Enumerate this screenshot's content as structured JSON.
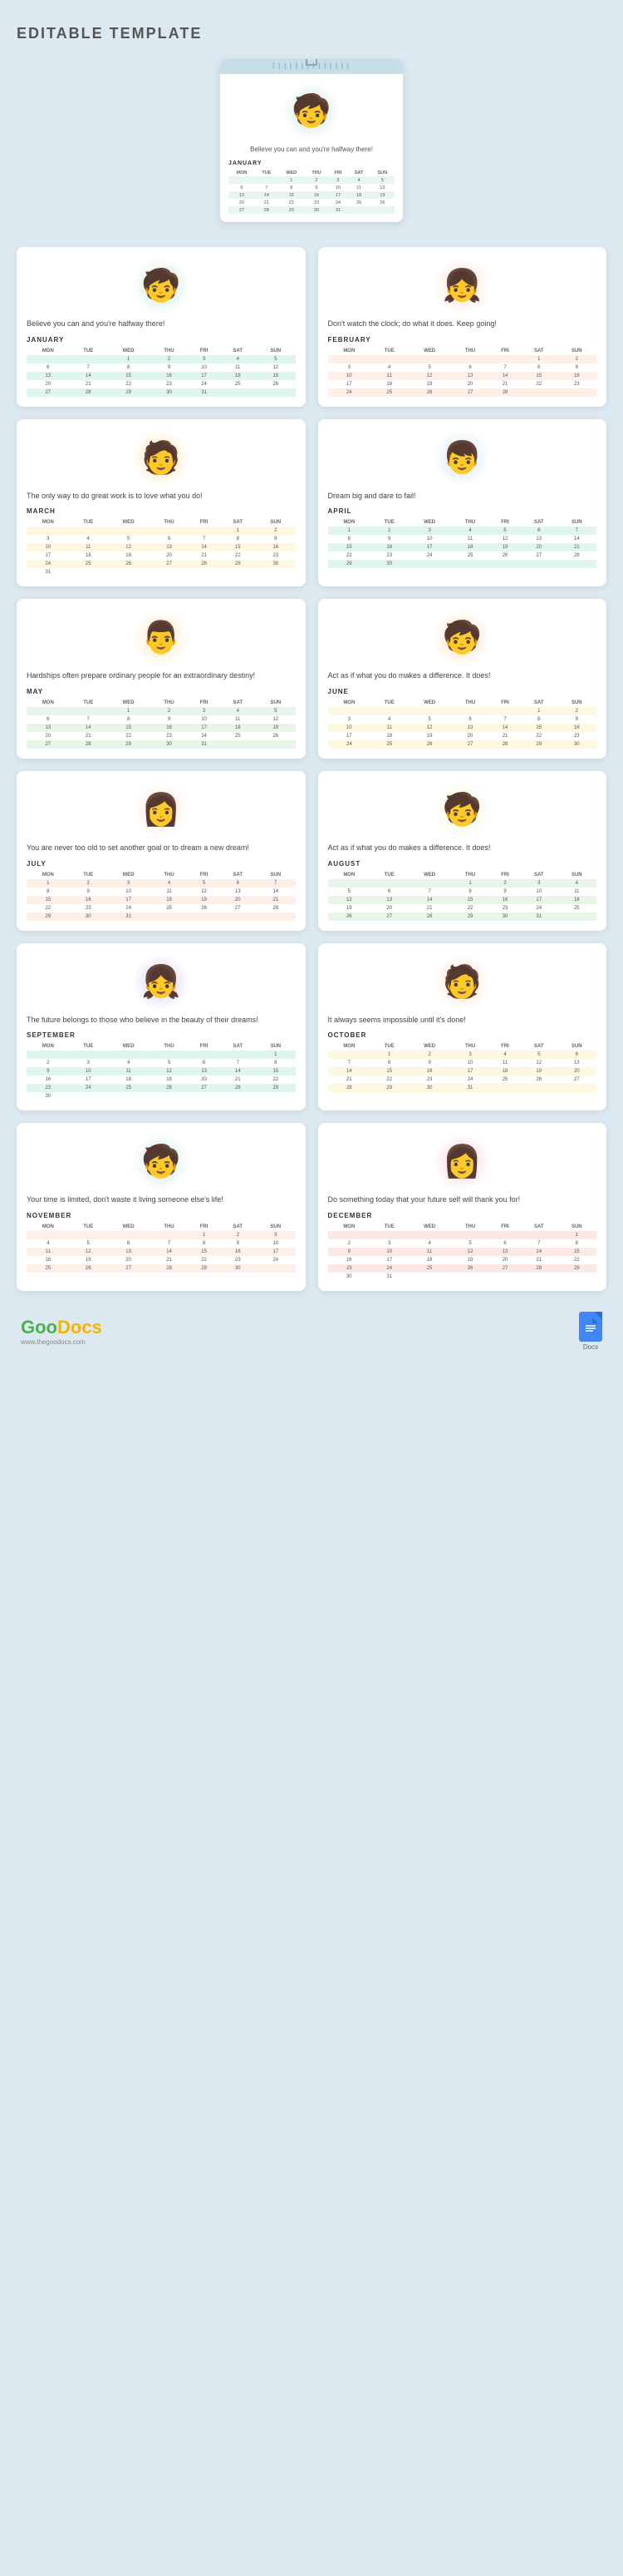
{
  "page": {
    "title": "EDITABLE TEMPLATE",
    "background": "#dce9f0"
  },
  "preview": {
    "quote": "Believe you can and you're halfway there!",
    "month": "JANUARY",
    "illustration": "🧒"
  },
  "months": [
    {
      "id": "january",
      "name": "JANUARY",
      "quote": "Believe you can and you're halfway there!",
      "illustration": "🧒",
      "illustration_class": "illus-jan",
      "rows": [
        [
          "",
          "",
          "1",
          "2",
          "3",
          "4",
          "5"
        ],
        [
          "6",
          "7",
          "8",
          "9",
          "10",
          "11",
          "12"
        ],
        [
          "13",
          "14",
          "15",
          "16",
          "17",
          "18",
          "19"
        ],
        [
          "20",
          "21",
          "22",
          "23",
          "24",
          "25",
          "26"
        ],
        [
          "27",
          "28",
          "29",
          "30",
          "31",
          "",
          ""
        ]
      ],
      "row_classes": [
        "row-teal",
        "row-white",
        "row-teal",
        "row-white",
        "row-teal"
      ]
    },
    {
      "id": "february",
      "name": "FEBRUARY",
      "quote": "Don't watch the clock; do what it does. Keep going!",
      "illustration": "👧",
      "illustration_class": "illus-feb",
      "rows": [
        [
          "",
          "",
          "",
          "",
          "",
          "1",
          "2"
        ],
        [
          "3",
          "4",
          "5",
          "6",
          "7",
          "8",
          "9"
        ],
        [
          "10",
          "11",
          "12",
          "13",
          "14",
          "15",
          "16"
        ],
        [
          "17",
          "18",
          "19",
          "20",
          "21",
          "22",
          "23"
        ],
        [
          "24",
          "25",
          "26",
          "27",
          "28",
          "",
          ""
        ]
      ],
      "row_classes": [
        "row-peach",
        "row-white",
        "row-peach",
        "row-white",
        "row-peach"
      ]
    },
    {
      "id": "march",
      "name": "MARCH",
      "quote": "The only way to do great work is to love what you do!",
      "illustration": "🧑",
      "illustration_class": "illus-mar",
      "rows": [
        [
          "",
          "",
          "",
          "",
          "",
          "1",
          "2"
        ],
        [
          "3",
          "4",
          "5",
          "6",
          "7",
          "8",
          "9"
        ],
        [
          "10",
          "11",
          "12",
          "13",
          "14",
          "15",
          "16"
        ],
        [
          "17",
          "18",
          "19",
          "20",
          "21",
          "22",
          "23"
        ],
        [
          "24",
          "25",
          "26",
          "27",
          "28",
          "29",
          "30"
        ],
        [
          "31",
          "",
          "",
          "",
          "",
          "",
          ""
        ]
      ],
      "row_classes": [
        "row-yellow",
        "row-white",
        "row-yellow",
        "row-white",
        "row-yellow",
        "row-white"
      ]
    },
    {
      "id": "april",
      "name": "APRIL",
      "quote": "Dream big and dare to fail!",
      "illustration": "👦",
      "illustration_class": "illus-apr",
      "rows": [
        [
          "1",
          "2",
          "3",
          "4",
          "5",
          "6",
          "7"
        ],
        [
          "8",
          "9",
          "10",
          "11",
          "12",
          "13",
          "14"
        ],
        [
          "15",
          "16",
          "17",
          "18",
          "19",
          "20",
          "21"
        ],
        [
          "22",
          "23",
          "24",
          "25",
          "26",
          "27",
          "28"
        ],
        [
          "29",
          "30",
          "",
          "",
          "",
          "",
          ""
        ]
      ],
      "row_classes": [
        "row-teal",
        "row-white",
        "row-teal",
        "row-white",
        "row-teal"
      ]
    },
    {
      "id": "may",
      "name": "MAY",
      "quote": "Hardships often prepare ordinary people for an extraordinary destiny!",
      "illustration": "👨",
      "illustration_class": "illus-may",
      "rows": [
        [
          "",
          "",
          "1",
          "2",
          "3",
          "4",
          "5"
        ],
        [
          "6",
          "7",
          "8",
          "9",
          "10",
          "11",
          "12"
        ],
        [
          "13",
          "14",
          "15",
          "16",
          "17",
          "18",
          "19"
        ],
        [
          "20",
          "21",
          "22",
          "23",
          "24",
          "25",
          "26"
        ],
        [
          "27",
          "28",
          "29",
          "30",
          "31",
          "",
          ""
        ]
      ],
      "row_classes": [
        "row-green",
        "row-white",
        "row-green",
        "row-white",
        "row-green"
      ]
    },
    {
      "id": "june",
      "name": "JUNE",
      "quote": "Act as if what you do makes a difference. It does!",
      "illustration": "🧒",
      "illustration_class": "illus-jun",
      "rows": [
        [
          "",
          "",
          "",
          "",
          "",
          "1",
          "2"
        ],
        [
          "3",
          "4",
          "5",
          "6",
          "7",
          "8",
          "9"
        ],
        [
          "10",
          "11",
          "12",
          "13",
          "14",
          "15",
          "16"
        ],
        [
          "17",
          "18",
          "19",
          "20",
          "21",
          "22",
          "23"
        ],
        [
          "24",
          "25",
          "26",
          "27",
          "28",
          "29",
          "30"
        ]
      ],
      "row_classes": [
        "row-yellow",
        "row-white",
        "row-yellow",
        "row-white",
        "row-yellow"
      ]
    },
    {
      "id": "july",
      "name": "JULY",
      "quote": "You are never too old to set another goal or to dream a new dream!",
      "illustration": "👩",
      "illustration_class": "illus-jul",
      "rows": [
        [
          "1",
          "2",
          "3",
          "4",
          "5",
          "6",
          "7"
        ],
        [
          "8",
          "9",
          "10",
          "11",
          "12",
          "13",
          "14"
        ],
        [
          "15",
          "16",
          "17",
          "18",
          "19",
          "20",
          "21"
        ],
        [
          "22",
          "23",
          "24",
          "25",
          "26",
          "27",
          "28"
        ],
        [
          "29",
          "30",
          "31",
          "",
          "",
          "",
          ""
        ]
      ],
      "row_classes": [
        "row-peach",
        "row-white",
        "row-peach",
        "row-white",
        "row-peach"
      ]
    },
    {
      "id": "august",
      "name": "AUGUST",
      "quote": "Act as if what you do makes a difference. It does!",
      "illustration": "🧒",
      "illustration_class": "illus-aug",
      "rows": [
        [
          "",
          "",
          "",
          "1",
          "2",
          "3",
          "4"
        ],
        [
          "5",
          "6",
          "7",
          "8",
          "9",
          "10",
          "11"
        ],
        [
          "12",
          "13",
          "14",
          "15",
          "16",
          "17",
          "18"
        ],
        [
          "19",
          "20",
          "21",
          "22",
          "23",
          "24",
          "25"
        ],
        [
          "26",
          "27",
          "28",
          "29",
          "30",
          "31",
          ""
        ]
      ],
      "row_classes": [
        "row-green",
        "row-white",
        "row-green",
        "row-white",
        "row-green"
      ]
    },
    {
      "id": "september",
      "name": "SEPTEMBER",
      "quote": "The future belongs to those who believe in the beauty of their dreams!",
      "illustration": "👧",
      "illustration_class": "illus-sep",
      "rows": [
        [
          "",
          "",
          "",
          "",
          "",
          "",
          "1"
        ],
        [
          "2",
          "3",
          "4",
          "5",
          "6",
          "7",
          "8"
        ],
        [
          "9",
          "10",
          "11",
          "12",
          "13",
          "14",
          "15"
        ],
        [
          "16",
          "17",
          "18",
          "19",
          "20",
          "21",
          "22"
        ],
        [
          "23",
          "24",
          "25",
          "26",
          "27",
          "28",
          "29"
        ],
        [
          "30",
          "",
          "",
          "",
          "",
          "",
          ""
        ]
      ],
      "row_classes": [
        "row-teal",
        "row-white",
        "row-teal",
        "row-white",
        "row-teal",
        "row-white"
      ]
    },
    {
      "id": "october",
      "name": "OCTOBER",
      "quote": "It always seems impossible until it's done!",
      "illustration": "🧑",
      "illustration_class": "illus-oct",
      "rows": [
        [
          "",
          "1",
          "2",
          "3",
          "4",
          "5",
          "6"
        ],
        [
          "7",
          "8",
          "9",
          "10",
          "11",
          "12",
          "13"
        ],
        [
          "14",
          "15",
          "16",
          "17",
          "18",
          "19",
          "20"
        ],
        [
          "21",
          "22",
          "23",
          "24",
          "25",
          "26",
          "27"
        ],
        [
          "28",
          "29",
          "30",
          "31",
          "",
          "",
          ""
        ]
      ],
      "row_classes": [
        "row-yellow",
        "row-white",
        "row-yellow",
        "row-white",
        "row-yellow"
      ]
    },
    {
      "id": "november",
      "name": "NOVEMBER",
      "quote": "Your time is limited, don't waste it living someone else's life!",
      "illustration": "🧒",
      "illustration_class": "illus-nov",
      "rows": [
        [
          "",
          "",
          "",
          "",
          "1",
          "2",
          "3"
        ],
        [
          "4",
          "5",
          "6",
          "7",
          "8",
          "9",
          "10"
        ],
        [
          "11",
          "12",
          "13",
          "14",
          "15",
          "16",
          "17"
        ],
        [
          "18",
          "19",
          "20",
          "21",
          "22",
          "23",
          "24"
        ],
        [
          "25",
          "26",
          "27",
          "28",
          "29",
          "30",
          ""
        ]
      ],
      "row_classes": [
        "row-peach",
        "row-white",
        "row-peach",
        "row-white",
        "row-peach"
      ]
    },
    {
      "id": "december",
      "name": "DECEMBER",
      "quote": "Do something today that your future self will thank you for!",
      "illustration": "👩",
      "illustration_class": "illus-dec",
      "rows": [
        [
          "",
          "",
          "",
          "",
          "",
          "",
          "1"
        ],
        [
          "2",
          "3",
          "4",
          "5",
          "6",
          "7",
          "8"
        ],
        [
          "9",
          "10",
          "11",
          "12",
          "13",
          "14",
          "15"
        ],
        [
          "16",
          "17",
          "18",
          "19",
          "20",
          "21",
          "22"
        ],
        [
          "23",
          "24",
          "25",
          "26",
          "27",
          "28",
          "29"
        ],
        [
          "30",
          "31",
          "",
          "",
          "",
          "",
          ""
        ]
      ],
      "row_classes": [
        "row-pink",
        "row-white",
        "row-pink",
        "row-white",
        "row-pink",
        "row-white"
      ]
    }
  ],
  "calendar_headers": [
    "MON",
    "TUE",
    "WED",
    "THU",
    "FRI",
    "SAT",
    "SUN"
  ],
  "footer": {
    "logo_goo": "Goo",
    "logo_docs": "Docs",
    "logo_sub": "www.thegoodocs.com",
    "docs_label": "Docs"
  }
}
